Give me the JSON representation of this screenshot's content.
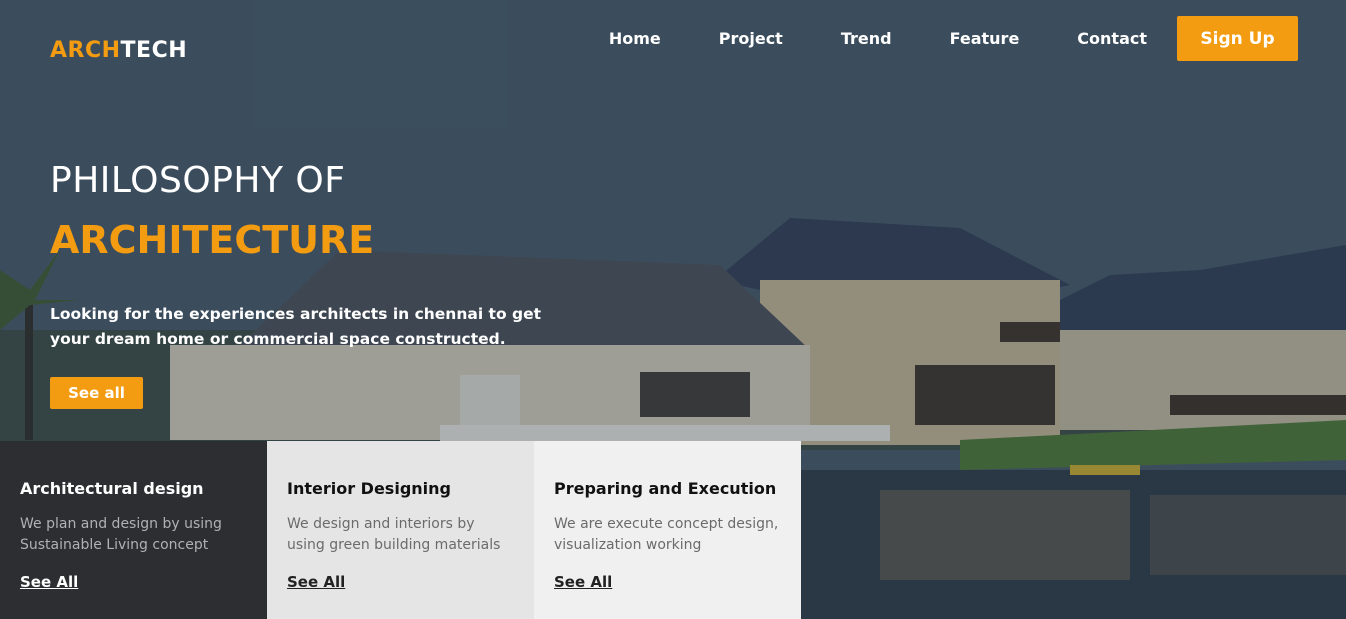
{
  "header": {
    "logo_accent": "ARCH",
    "logo_rest": "TECH",
    "nav": [
      "Home",
      "Project",
      "Trend",
      "Feature",
      "Contact"
    ],
    "signup_label": "Sign Up"
  },
  "hero": {
    "title_line1": "PHILOSOPHY OF",
    "title_line2": "ARCHITECTURE",
    "description": "Looking for the experiences architects in chennai to get your dream home or commercial space constructed.",
    "cta_label": "See all"
  },
  "cards": [
    {
      "title": "Architectural design",
      "text": "We plan and design by using Sustainable Living concept",
      "link": "See All"
    },
    {
      "title": "Interior Designing",
      "text": "We design and interiors by using green building materials",
      "link": "See All"
    },
    {
      "title": "Preparing and Execution",
      "text": "We are execute concept design, visualization working",
      "link": "See All"
    }
  ],
  "colors": {
    "accent": "#f39c12",
    "dark_card": "#2c2e31",
    "light_card": "#e5e5e5"
  }
}
